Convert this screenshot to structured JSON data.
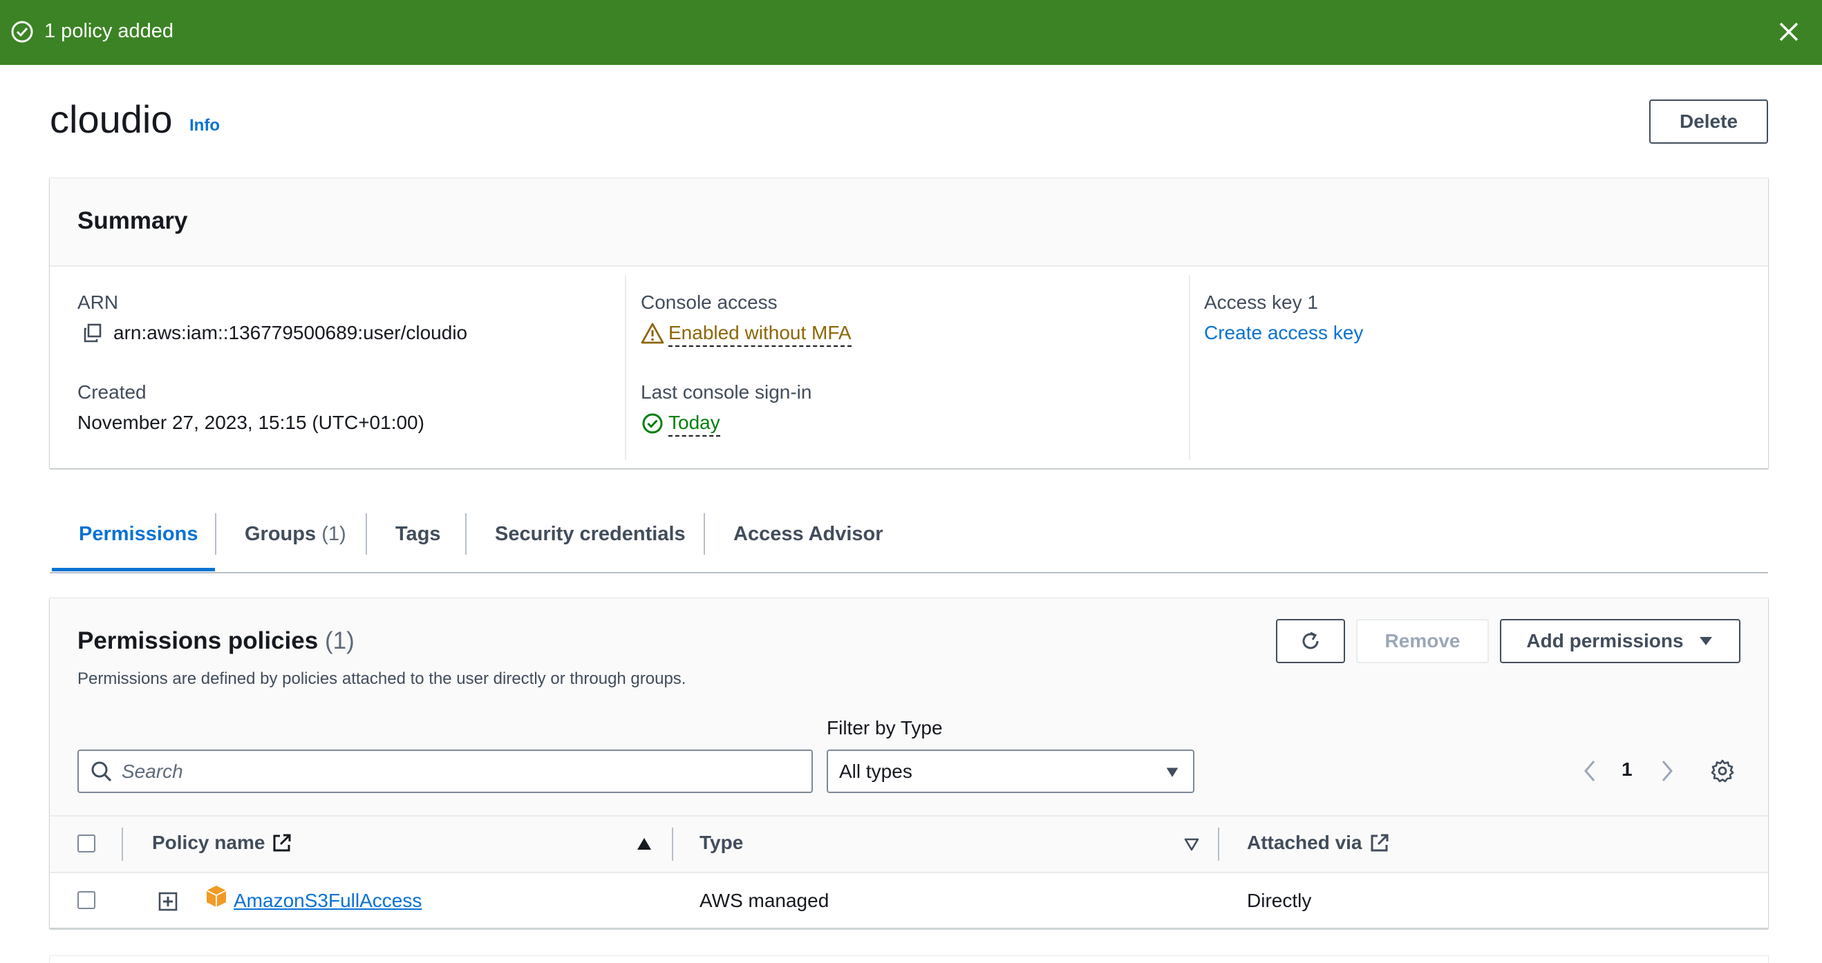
{
  "flash": {
    "message": "1 policy added",
    "color": "#3b8324"
  },
  "header": {
    "title": "cloudio",
    "info_label": "Info",
    "delete_label": "Delete"
  },
  "summary": {
    "title": "Summary",
    "arn_label": "ARN",
    "arn_value": "arn:aws:iam::136779500689:user/cloudio",
    "created_label": "Created",
    "created_value": "November 27, 2023, 15:15 (UTC+01:00)",
    "console_access_label": "Console access",
    "console_access_value": "Enabled without MFA",
    "last_signin_label": "Last console sign-in",
    "last_signin_value": "Today",
    "access_key_label": "Access key 1",
    "create_access_key": "Create access key"
  },
  "tabs": [
    {
      "label": "Permissions",
      "count": "",
      "active": true
    },
    {
      "label": "Groups",
      "count": "(1)",
      "active": false
    },
    {
      "label": "Tags",
      "count": "",
      "active": false
    },
    {
      "label": "Security credentials",
      "count": "",
      "active": false
    },
    {
      "label": "Access Advisor",
      "count": "",
      "active": false
    }
  ],
  "permissions": {
    "title": "Permissions policies",
    "count": "(1)",
    "description": "Permissions are defined by policies attached to the user directly or through groups.",
    "remove_label": "Remove",
    "add_permissions_label": "Add permissions",
    "search_placeholder": "Search",
    "filter_label": "Filter by Type",
    "filter_value": "All types",
    "page_number": "1",
    "columns": [
      "Policy name",
      "Type",
      "Attached via"
    ],
    "rows": [
      {
        "policy_name": "AmazonS3FullAccess",
        "type": "AWS managed",
        "attached_via": "Directly"
      }
    ]
  },
  "colors": {
    "link": "#0972d3",
    "warning": "#8d6605",
    "success": "#037f0c"
  }
}
